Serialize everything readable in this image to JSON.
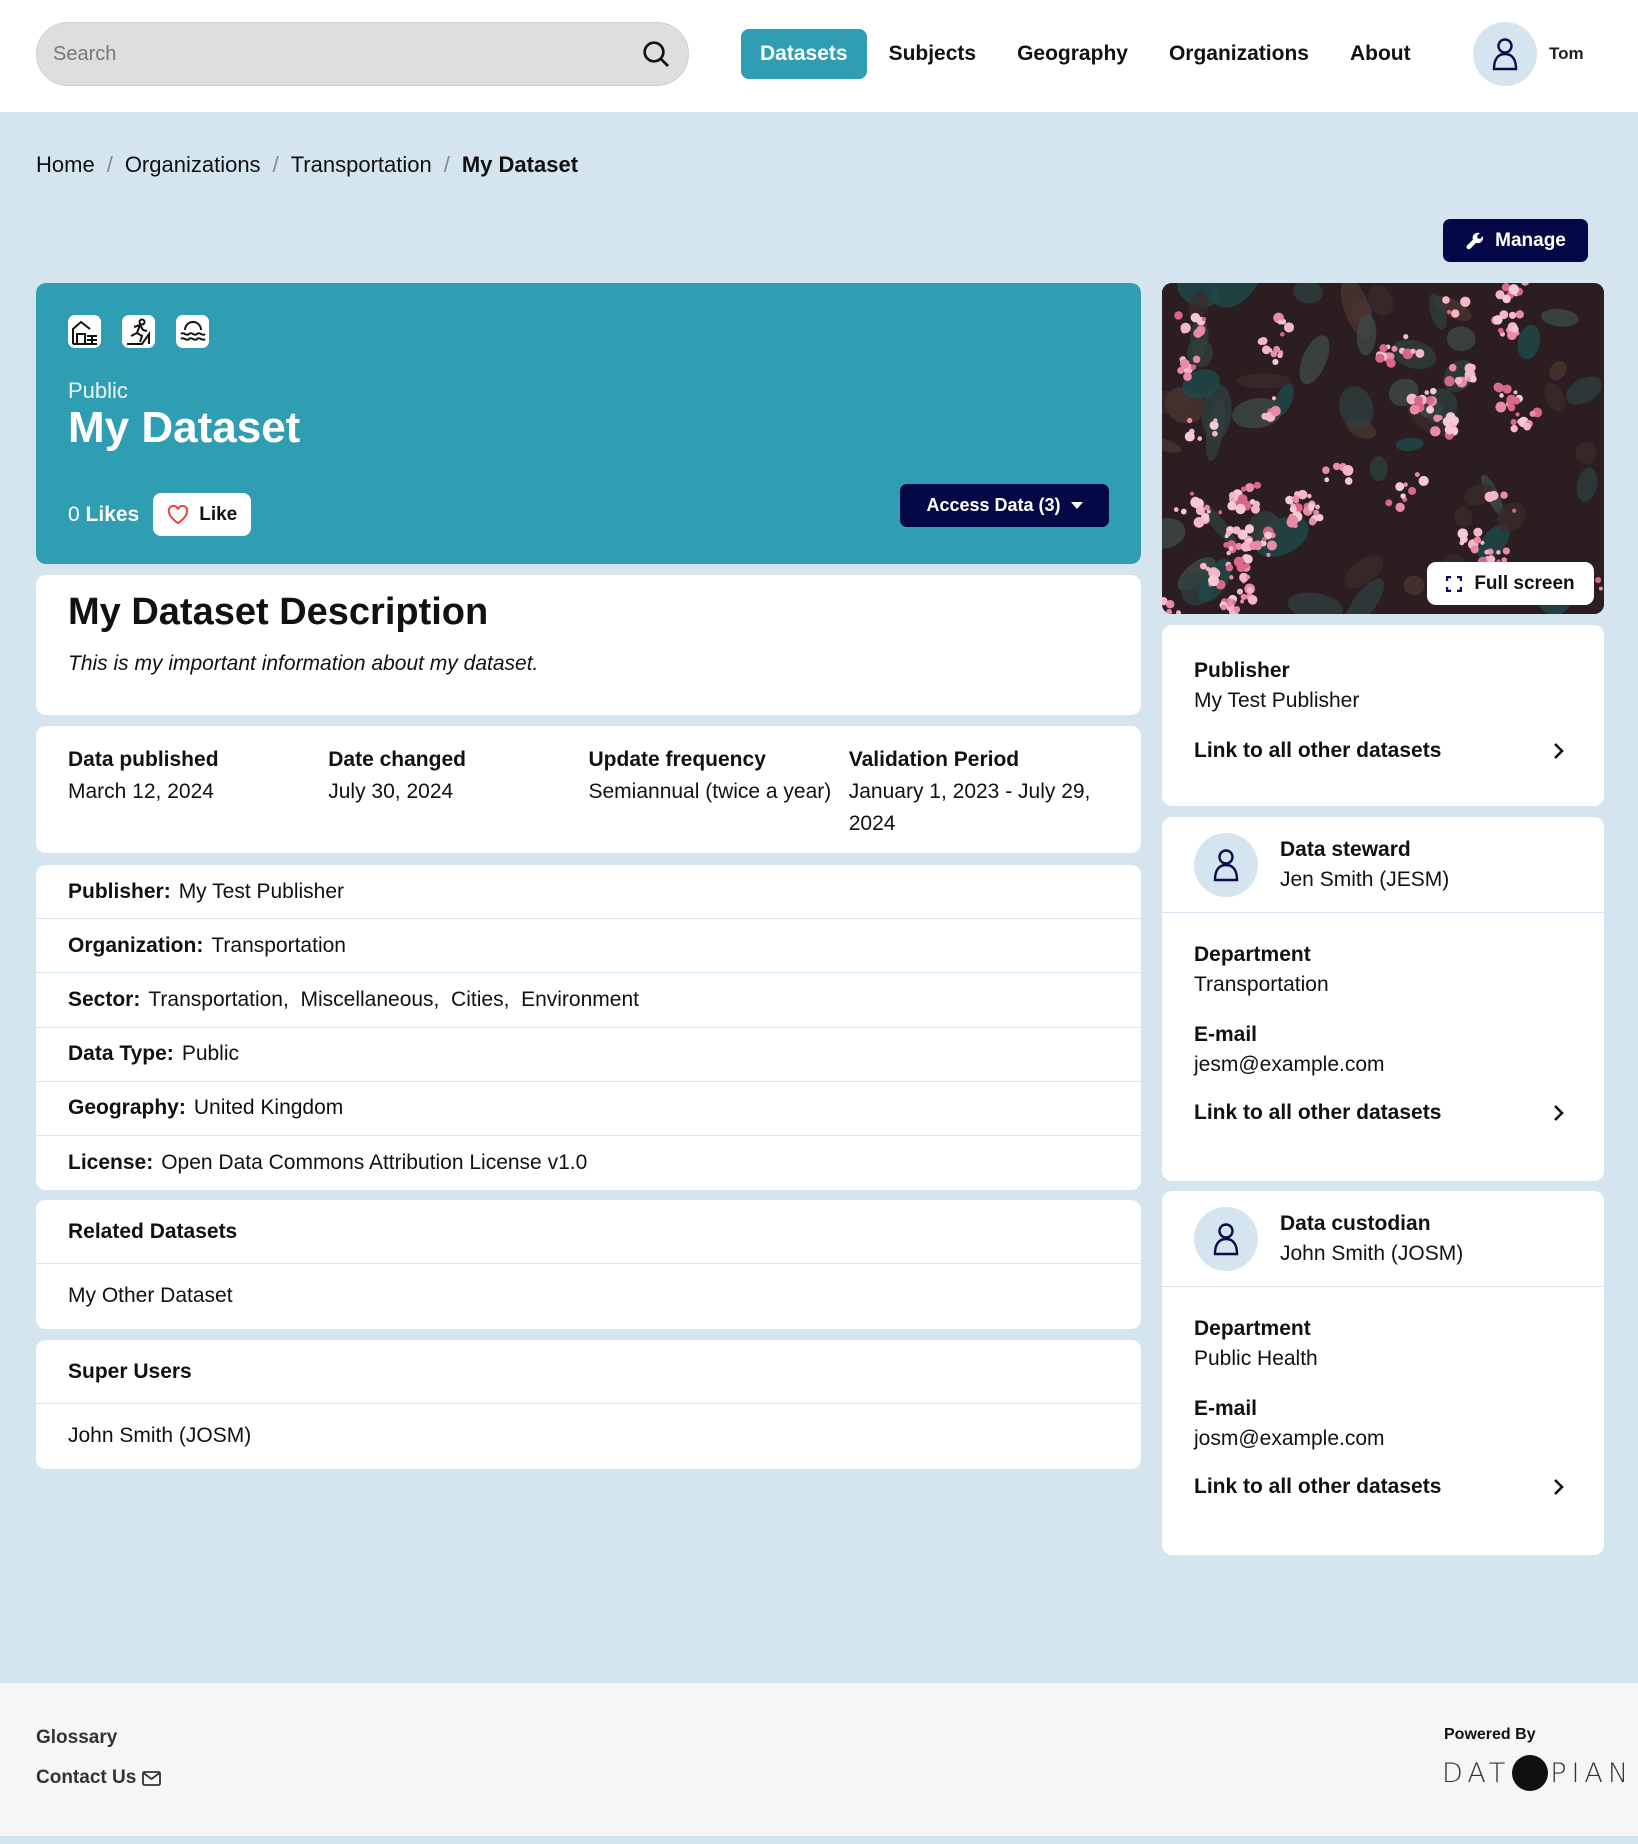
{
  "header": {
    "search_placeholder": "Search",
    "nav": [
      {
        "label": "Datasets",
        "active": true
      },
      {
        "label": "Subjects",
        "active": false
      },
      {
        "label": "Geography",
        "active": false
      },
      {
        "label": "Organizations",
        "active": false
      },
      {
        "label": "About",
        "active": false
      }
    ],
    "user_name": "Tom"
  },
  "breadcrumb": [
    "Home",
    "Organizations",
    "Transportation",
    "My Dataset"
  ],
  "manage_label": "Manage",
  "hero": {
    "subject_icons": [
      "house-icon",
      "runner-icon",
      "water-icon"
    ],
    "visibility": "Public",
    "title": "My Dataset",
    "likes_count": "0",
    "likes_label": "Likes",
    "like_button": "Like",
    "access_button": "Access Data (3)"
  },
  "description": {
    "title": "My Dataset Description",
    "text": "This is my important information about my dataset."
  },
  "dates": [
    {
      "label": "Data published",
      "value": "March 12, 2024"
    },
    {
      "label": "Date changed",
      "value": "July 30, 2024"
    },
    {
      "label": "Update frequency",
      "value": "Semiannual (twice a year)"
    },
    {
      "label": "Validation Period",
      "value": "January 1, 2023 - July 29, 2024"
    }
  ],
  "properties": [
    {
      "label": "Publisher:",
      "value": "My Test Publisher"
    },
    {
      "label": "Organization:",
      "value": "Transportation"
    },
    {
      "label": "Sector:",
      "value": "Transportation,  Miscellaneous,  Cities,  Environment"
    },
    {
      "label": "Data Type:",
      "value": "Public"
    },
    {
      "label": "Geography:",
      "value": "United Kingdom"
    },
    {
      "label": "License:",
      "value": "Open Data Commons Attribution License v1.0"
    }
  ],
  "related": {
    "title": "Related Datasets",
    "items": [
      "My Other Dataset"
    ]
  },
  "super_users": {
    "title": "Super Users",
    "items": [
      "John Smith (JOSM)"
    ]
  },
  "image": {
    "fullscreen_label": "Full screen"
  },
  "publisher_card": {
    "label": "Publisher",
    "value": "My Test Publisher",
    "link": "Link to all other datasets"
  },
  "steward": {
    "role": "Data steward",
    "name": "Jen Smith (JESM)",
    "department_label": "Department",
    "department": "Transportation",
    "email_label": "E-mail",
    "email": "jesm@example.com",
    "link": "Link to all other datasets"
  },
  "custodian": {
    "role": "Data custodian",
    "name": "John Smith (JOSM)",
    "department_label": "Department",
    "department": "Public Health",
    "email_label": "E-mail",
    "email": "josm@example.com",
    "link": "Link to all other datasets"
  },
  "footer": {
    "glossary": "Glossary",
    "contact": "Contact Us",
    "powered_by": "Powered By",
    "logo_left": "DAT",
    "logo_right": "PIAN"
  },
  "colors": {
    "accent": "#309eb2",
    "dark_button": "#050847",
    "page_bg": "#d5e5f0"
  }
}
